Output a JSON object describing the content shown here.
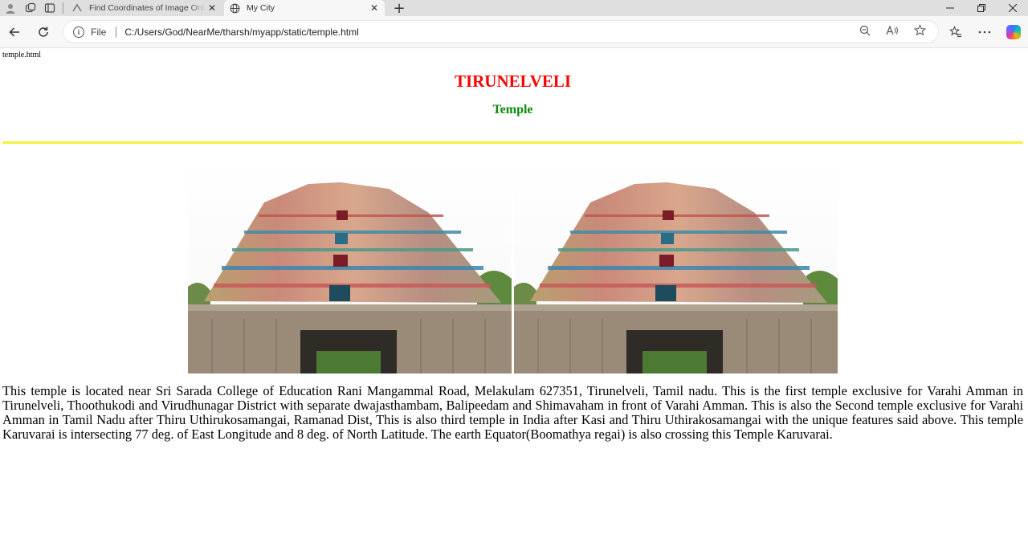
{
  "browser": {
    "tabs": [
      {
        "title": "Find Coordinates of Image Online",
        "active": false
      },
      {
        "title": "My City",
        "active": true
      }
    ],
    "address": {
      "scheme_label": "File",
      "url": "C:/Users/God/NearMe/tharsh/myapp/static/temple.html"
    }
  },
  "page": {
    "filename": "temple.html",
    "title": "TIRUNELVELI",
    "subtitle": "Temple",
    "title_color": "#ff0000",
    "subtitle_color": "#0b8a0b",
    "rule_color": "#f4f141",
    "images": [
      {
        "name": "temple-gopuram-image-1"
      },
      {
        "name": "temple-gopuram-image-2"
      }
    ],
    "description": "This temple is located near Sri Sarada College of Education Rani Mangammal Road, Melakulam 627351, Tirunelveli, Tamil nadu. This is the first temple exclusive for Varahi Amman in Tirunelveli, Thoothukodi and Virudhunagar District with separate dwajasthambam, Balipeedam and Shimavaham in front of Varahi Amman. This is also the Second temple exclusive for Varahi Amman in Tamil Nadu after Thiru Uthirukosamangai, Ramanad Dist, This is also third temple in India after Kasi and Thiru Uthirakosamangai with the unique features said above. This temple Karuvarai is intersecting 77 deg. of East Longitude and 8 deg. of North Latitude. The earth Equator(Boomathya regai) is also crossing this Temple Karuvarai."
  }
}
